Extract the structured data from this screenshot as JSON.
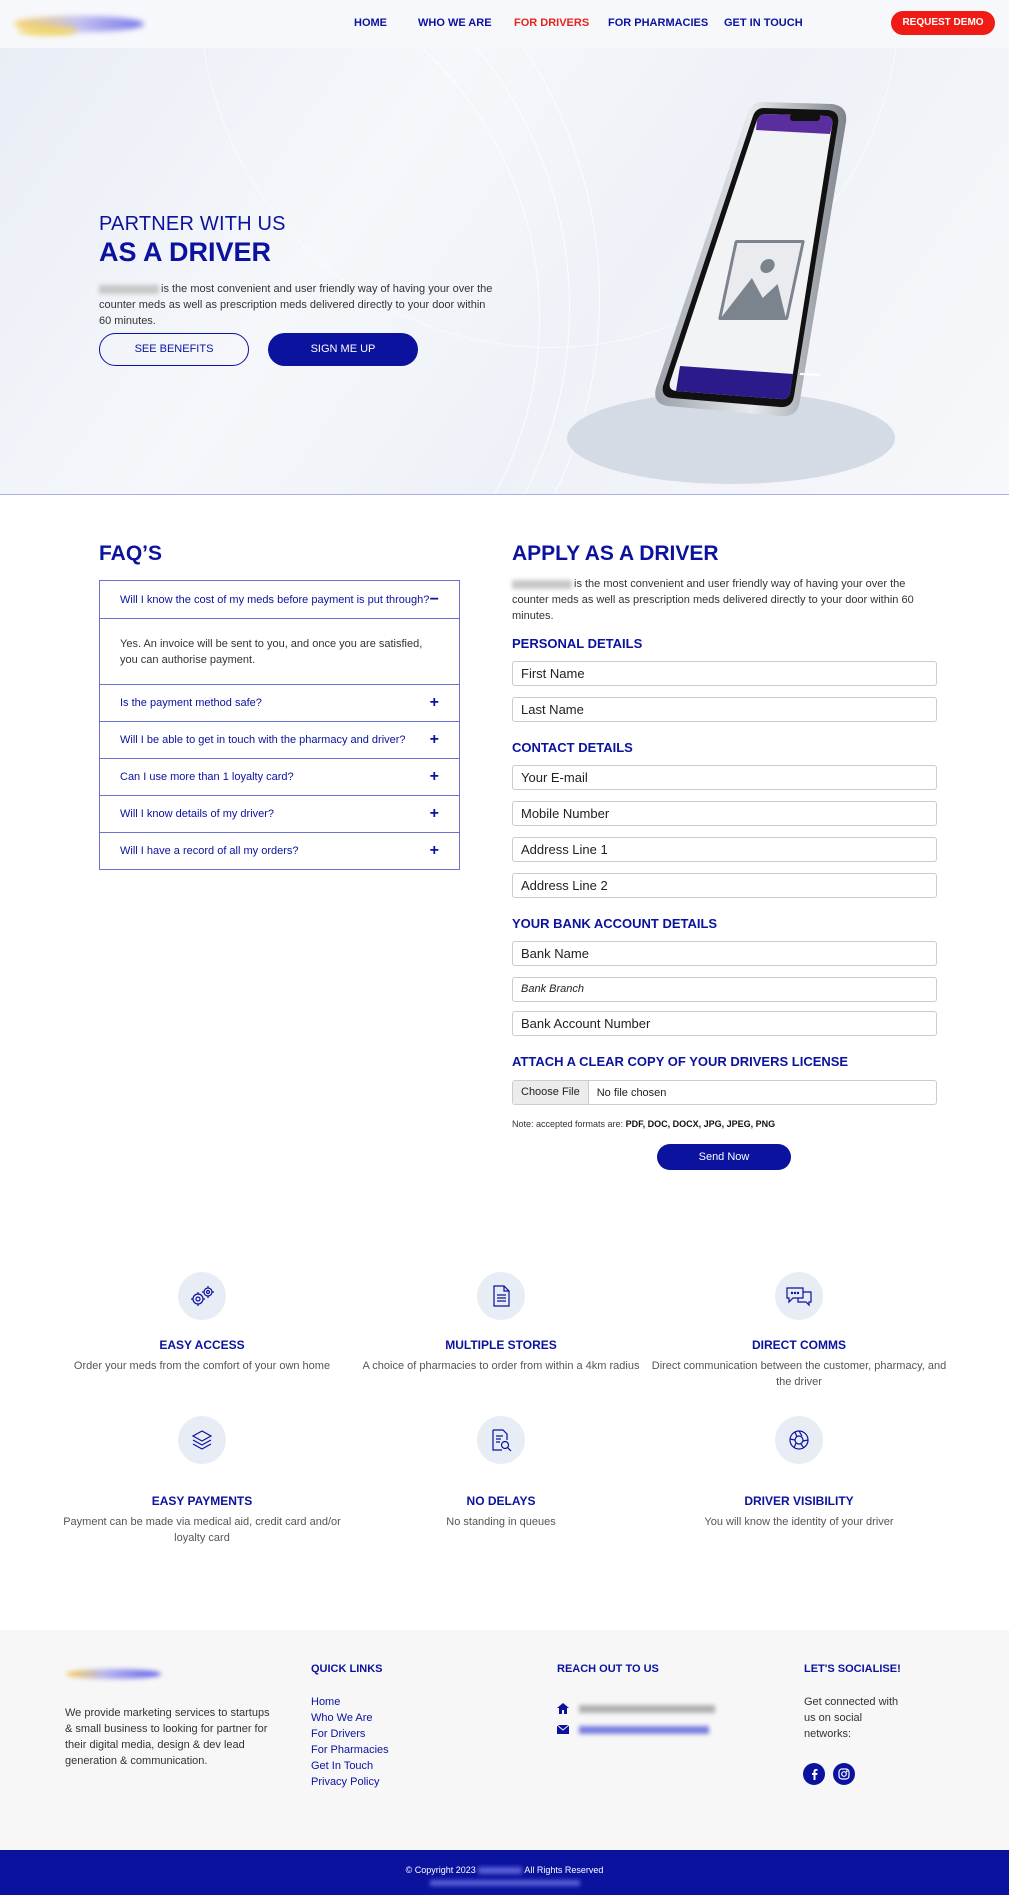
{
  "header": {
    "nav": [
      {
        "label": "HOME"
      },
      {
        "label": "WHO WE ARE"
      },
      {
        "label": "FOR DRIVERS"
      },
      {
        "label": "FOR PHARMACIES"
      },
      {
        "label": "GET IN TOUCH"
      }
    ],
    "cta": "REQUEST DEMO"
  },
  "hero": {
    "subtitle": "PARTNER WITH US",
    "title": "AS A DRIVER",
    "description": "is the most convenient and user friendly way of having your over the counter meds as well as prescription meds delivered directly to your door within 60 minutes.",
    "btn_benefits": "SEE BENEFITS",
    "btn_signup": "SIGN ME UP"
  },
  "faq": {
    "title": "FAQ’S",
    "open_question": "Will I know the cost of my meds before payment is put through?",
    "open_answer": "Yes. An invoice will be sent to you, and once you are satisfied, you can authorise payment.",
    "questions": [
      "Is the payment method safe?",
      "Will I be able to get in touch with the pharmacy and driver?",
      "Can I use more than 1 loyalty card?",
      "Will I know details of my driver?",
      "Will I have a record of all my orders?"
    ]
  },
  "apply": {
    "title": "APPLY AS A DRIVER",
    "description": "is the most convenient and user friendly way of having your over the counter meds as well as prescription meds delivered directly to your door within 60 minutes.",
    "personal_heading": "PERSONAL DETAILS",
    "first_name": "First Name",
    "last_name": "Last Name",
    "contact_heading": "CONTACT DETAILS",
    "email": "Your E-mail",
    "mobile": "Mobile Number",
    "address1": "Address Line 1",
    "address2": "Address Line 2",
    "bank_heading": "YOUR BANK ACCOUNT DETAILS",
    "bank_name": "Bank Name",
    "bank_branch": "Bank Branch",
    "account_number": "Bank Account Number",
    "license_heading": "ATTACH A CLEAR COPY OF YOUR DRIVERS LICENSE",
    "choose_file": "Choose File",
    "no_file": "No file chosen",
    "note_prefix": "Note: accepted formats are:",
    "note_formats": "PDF, DOC, DOCX, JPG, JPEG, PNG",
    "send": "Send Now"
  },
  "features": [
    {
      "icon": "gears-icon",
      "title": "EASY ACCESS",
      "desc": "Order your meds from the comfort of your own home"
    },
    {
      "icon": "document-icon",
      "title": "MULTIPLE STORES",
      "desc": "A choice of pharmacies to order from within a 4km radius"
    },
    {
      "icon": "chat-icon",
      "title": "DIRECT COMMS",
      "desc": "Direct communication between the customer, pharmacy, and the driver"
    },
    {
      "icon": "layers-icon",
      "title": "EASY PAYMENTS",
      "desc": "Payment can be made via medical aid, credit card and/or loyalty card"
    },
    {
      "icon": "search-document-icon",
      "title": "NO DELAYS",
      "desc": "No standing in queues"
    },
    {
      "icon": "aperture-icon",
      "title": "DRIVER VISIBILITY",
      "desc": "You will know the identity of your driver"
    }
  ],
  "footer": {
    "about": "We provide marketing services to startups & small business to looking for partner for their digital media, design & dev lead generation & communication.",
    "quick_links_heading": "QUICK LINKS",
    "links": [
      "Home",
      "Who We Are",
      "For Drivers",
      "For Pharmacies",
      "Get In Touch",
      "Privacy Policy"
    ],
    "reach_heading": "REACH OUT TO US",
    "social_heading": "LET'S SOCIALISE!",
    "social_text": "Get connected with us on social networks:",
    "copyright_prefix": "© Copyright 2023",
    "copyright_suffix": "All Rights Reserved"
  },
  "colors": {
    "brand_navy": "#0a129e",
    "accent_red": "#f01b14"
  }
}
